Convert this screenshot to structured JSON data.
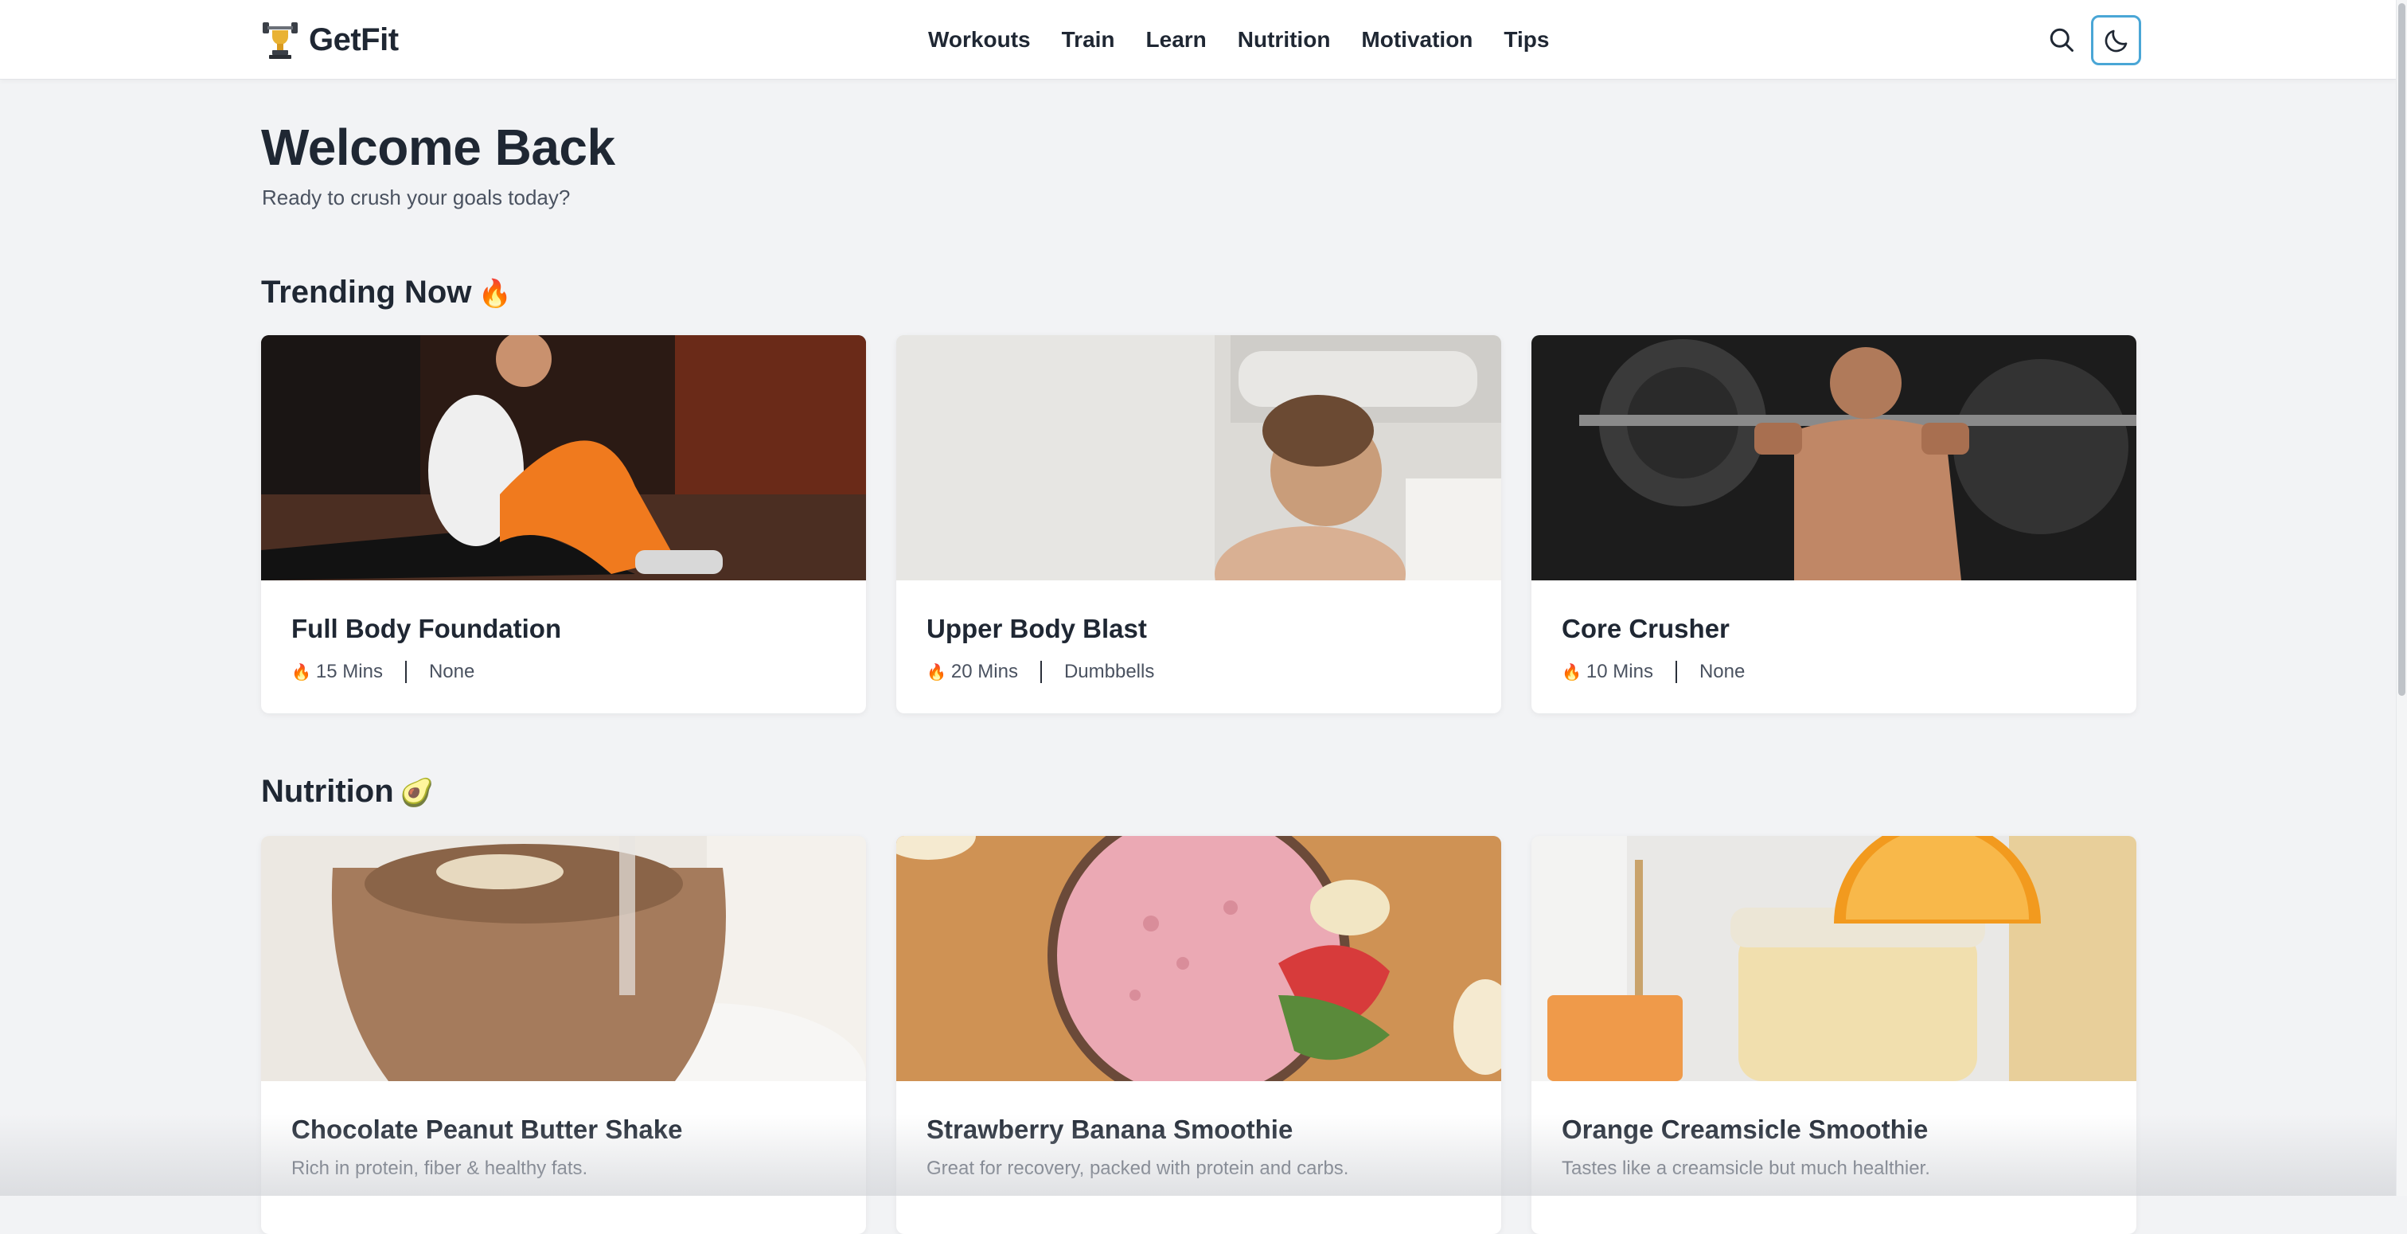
{
  "brand": {
    "name": "GetFit",
    "logo_icon": "trophy-dumbbell-icon"
  },
  "nav": {
    "items": [
      {
        "label": "Workouts"
      },
      {
        "label": "Train"
      },
      {
        "label": "Learn"
      },
      {
        "label": "Nutrition"
      },
      {
        "label": "Motivation"
      },
      {
        "label": "Tips"
      }
    ]
  },
  "header_actions": {
    "search_icon": "search-icon",
    "theme_icon": "moon-icon"
  },
  "hero": {
    "title": "Welcome Back",
    "subtitle": "Ready to crush your goals today?"
  },
  "trending": {
    "title": "Trending Now",
    "emoji": "🔥",
    "cards": [
      {
        "title": "Full Body Foundation",
        "fire": "🔥",
        "duration": "15 Mins",
        "equipment": "None"
      },
      {
        "title": "Upper Body Blast",
        "fire": "🔥",
        "duration": "20 Mins",
        "equipment": "Dumbbells"
      },
      {
        "title": "Core Crusher",
        "fire": "🔥",
        "duration": "10 Mins",
        "equipment": "None"
      }
    ]
  },
  "nutrition": {
    "title": "Nutrition",
    "emoji": "🥑",
    "cards": [
      {
        "title": "Chocolate Peanut Butter Shake",
        "description": "Rich in protein, fiber & healthy fats."
      },
      {
        "title": "Strawberry Banana Smoothie",
        "description": "Great for recovery, packed with protein and carbs."
      },
      {
        "title": "Orange Creamsicle Smoothie",
        "description": "Tastes like a creamsicle but much healthier."
      }
    ]
  },
  "colors": {
    "accent_border": "#4aa6d6",
    "page_bg": "#f2f3f5",
    "text_dark": "#1f2733",
    "text_muted": "#4a5260"
  }
}
